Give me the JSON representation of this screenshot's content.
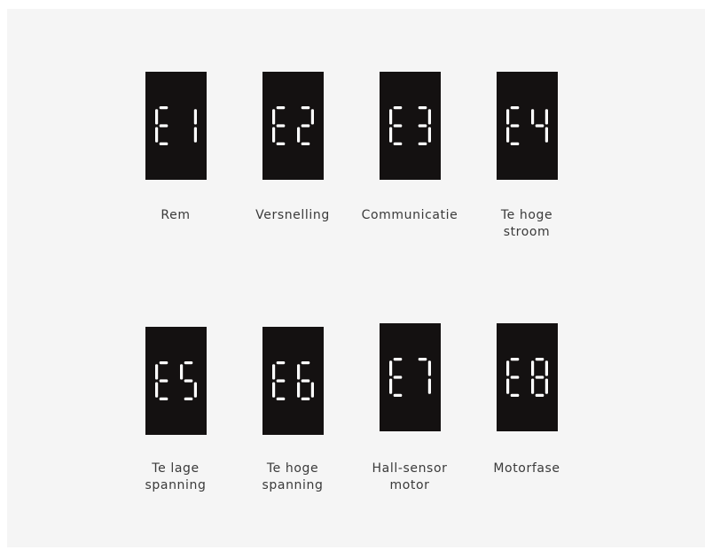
{
  "colors": {
    "background": "#f5f5f5",
    "display": "#141111",
    "segment": "#ffffff",
    "label": "#3a3a3a"
  },
  "codes": [
    {
      "code": "E1",
      "label": [
        "Rem"
      ]
    },
    {
      "code": "E2",
      "label": [
        "Versnelling"
      ]
    },
    {
      "code": "E3",
      "label": [
        "Communicatie"
      ]
    },
    {
      "code": "E4",
      "label": [
        "Te hoge",
        "stroom"
      ]
    },
    {
      "code": "E5",
      "label": [
        "Te lage",
        "spanning"
      ]
    },
    {
      "code": "E6",
      "label": [
        "Te hoge",
        "spanning"
      ]
    },
    {
      "code": "E7",
      "label": [
        "Hall-sensor",
        "motor"
      ]
    },
    {
      "code": "E8",
      "label": [
        "Motorfase"
      ]
    }
  ]
}
